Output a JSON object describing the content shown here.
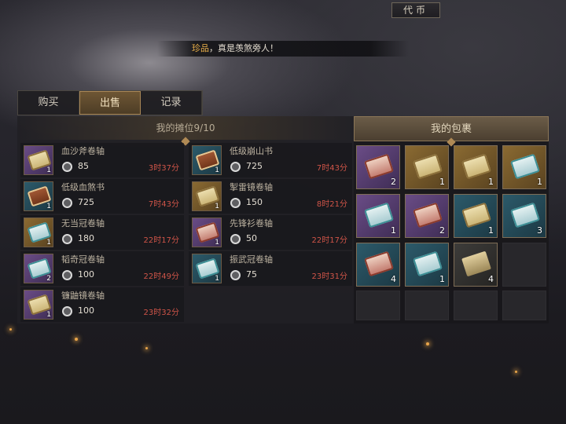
{
  "header": {
    "currency_label": "代币"
  },
  "ticker": {
    "highlight": "珍品",
    "message": "，真是羡煞旁人！"
  },
  "tabs": [
    {
      "label": "购买",
      "active": false
    },
    {
      "label": "出售",
      "active": true
    },
    {
      "label": "记录",
      "active": false
    }
  ],
  "stall": {
    "title": "我的摊位9/10",
    "items": [
      {
        "name": "血沙斧卷轴",
        "price": "85",
        "time": "3时37分",
        "qty": "1",
        "icon": "paper-scroll-icon",
        "rarity": "purple"
      },
      {
        "name": "低级崩山书",
        "price": "725",
        "time": "7时43分",
        "qty": "1",
        "icon": "skill-book-icon",
        "rarity": "teal"
      },
      {
        "name": "低级血煞书",
        "price": "725",
        "time": "7时43分",
        "qty": "1",
        "icon": "skill-book-icon",
        "rarity": "teal"
      },
      {
        "name": "掣雷镜卷轴",
        "price": "150",
        "time": "8时21分",
        "qty": "1",
        "icon": "paper-scroll-icon",
        "rarity": "gold"
      },
      {
        "name": "无当冠卷轴",
        "price": "180",
        "time": "22时17分",
        "qty": "1",
        "icon": "jade-scroll-icon",
        "rarity": "gold"
      },
      {
        "name": "先锋衫卷轴",
        "price": "50",
        "time": "22时17分",
        "qty": "1",
        "icon": "red-scroll-icon",
        "rarity": "purple"
      },
      {
        "name": "韬奇冠卷轴",
        "price": "100",
        "time": "22时49分",
        "qty": "2",
        "icon": "jade-scroll-icon",
        "rarity": "purple"
      },
      {
        "name": "振武冠卷轴",
        "price": "75",
        "time": "23时31分",
        "qty": "1",
        "icon": "jade-scroll-icon",
        "rarity": "teal"
      },
      {
        "name": "镰鼬镜卷轴",
        "price": "100",
        "time": "23时32分",
        "qty": "1",
        "icon": "paper-scroll-icon",
        "rarity": "purple"
      }
    ]
  },
  "bag": {
    "title": "我的包裹",
    "cells": [
      {
        "qty": "2",
        "icon": "red-scroll-icon",
        "rarity": "purple"
      },
      {
        "qty": "1",
        "icon": "paper-scroll-icon",
        "rarity": "gold"
      },
      {
        "qty": "1",
        "icon": "paper-scroll-icon",
        "rarity": "gold"
      },
      {
        "qty": "1",
        "icon": "jade-scroll-icon",
        "rarity": "gold"
      },
      {
        "qty": "1",
        "icon": "jade-scroll-icon",
        "rarity": "purple"
      },
      {
        "qty": "2",
        "icon": "red-scroll-icon",
        "rarity": "purple"
      },
      {
        "qty": "1",
        "icon": "paper-scroll-icon",
        "rarity": "teal"
      },
      {
        "qty": "3",
        "icon": "jade-scroll-icon",
        "rarity": "teal"
      },
      {
        "qty": "4",
        "icon": "red-scroll-icon",
        "rarity": "teal"
      },
      {
        "qty": "1",
        "icon": "jade-scroll-icon",
        "rarity": "teal"
      },
      {
        "qty": "4",
        "icon": "stone-material-icon",
        "rarity": "gray"
      },
      {
        "qty": "",
        "icon": "",
        "rarity": ""
      },
      {
        "qty": "",
        "icon": "",
        "rarity": ""
      },
      {
        "qty": "",
        "icon": "",
        "rarity": ""
      },
      {
        "qty": "",
        "icon": "",
        "rarity": ""
      },
      {
        "qty": "",
        "icon": "",
        "rarity": ""
      }
    ]
  }
}
